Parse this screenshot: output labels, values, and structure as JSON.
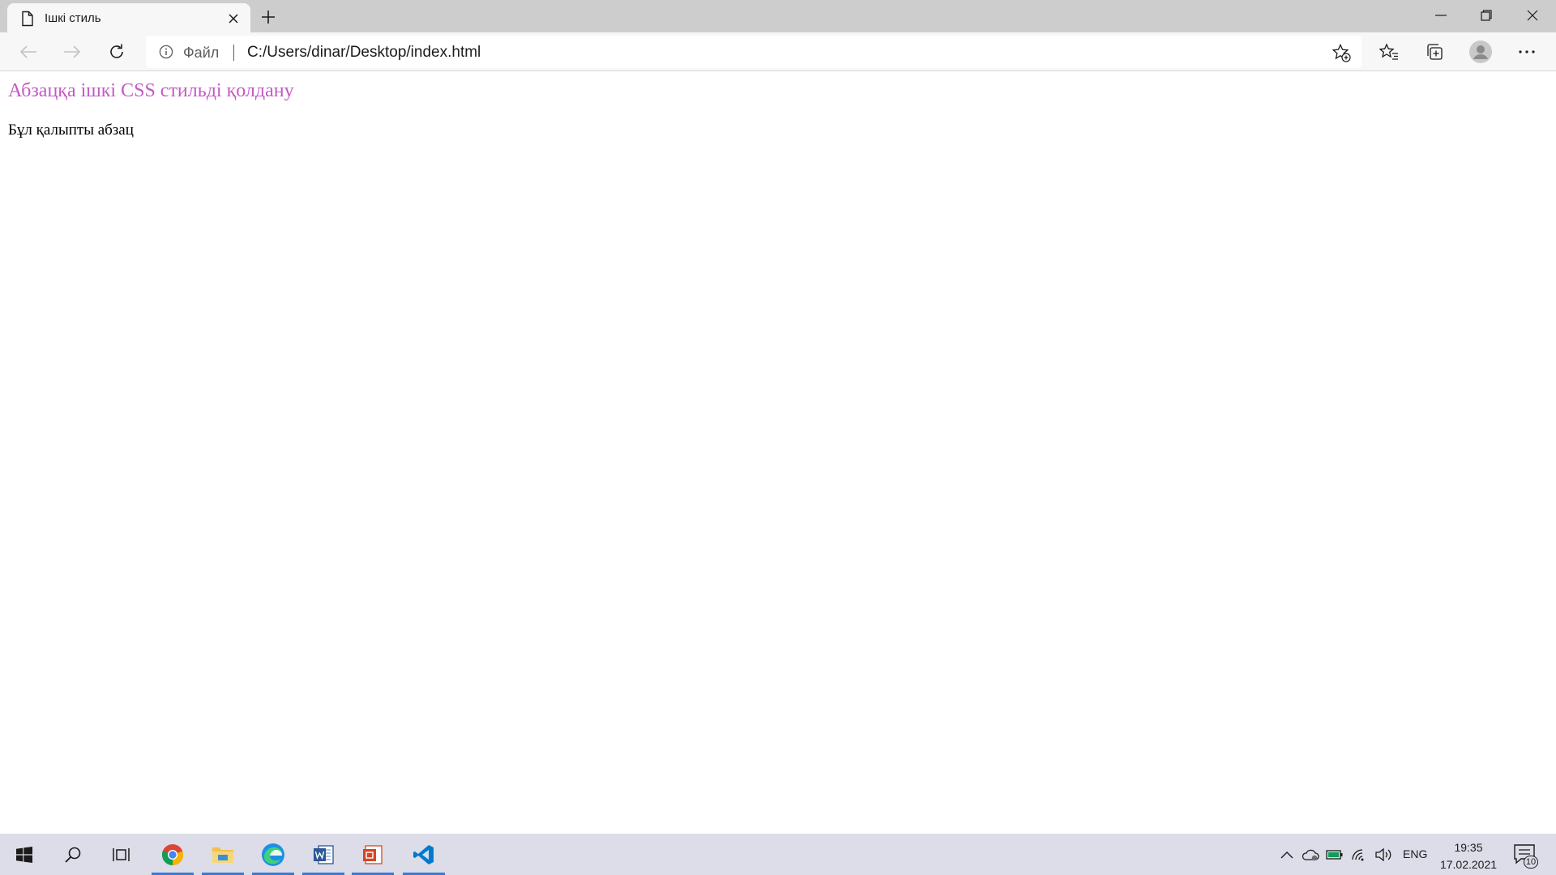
{
  "browser": {
    "tab": {
      "title": "Ішкі стиль"
    },
    "address": {
      "scheme_label": "Файл",
      "url": "C:/Users/dinar/Desktop/index.html"
    }
  },
  "page": {
    "styled_paragraph": "Абзацқа ішкі CSS стильді қолдану",
    "normal_paragraph": "Бұл қалыпты абзац",
    "styled_color": "#c45ac4"
  },
  "taskbar": {
    "apps": [
      "start-icon",
      "search-icon",
      "task-view-icon",
      "chrome-icon",
      "file-explorer-icon",
      "edge-icon",
      "word-icon",
      "app-icon",
      "vscode-icon"
    ],
    "language": "ENG",
    "time": "19:35",
    "date": "17.02.2021",
    "notification_count": "10"
  }
}
